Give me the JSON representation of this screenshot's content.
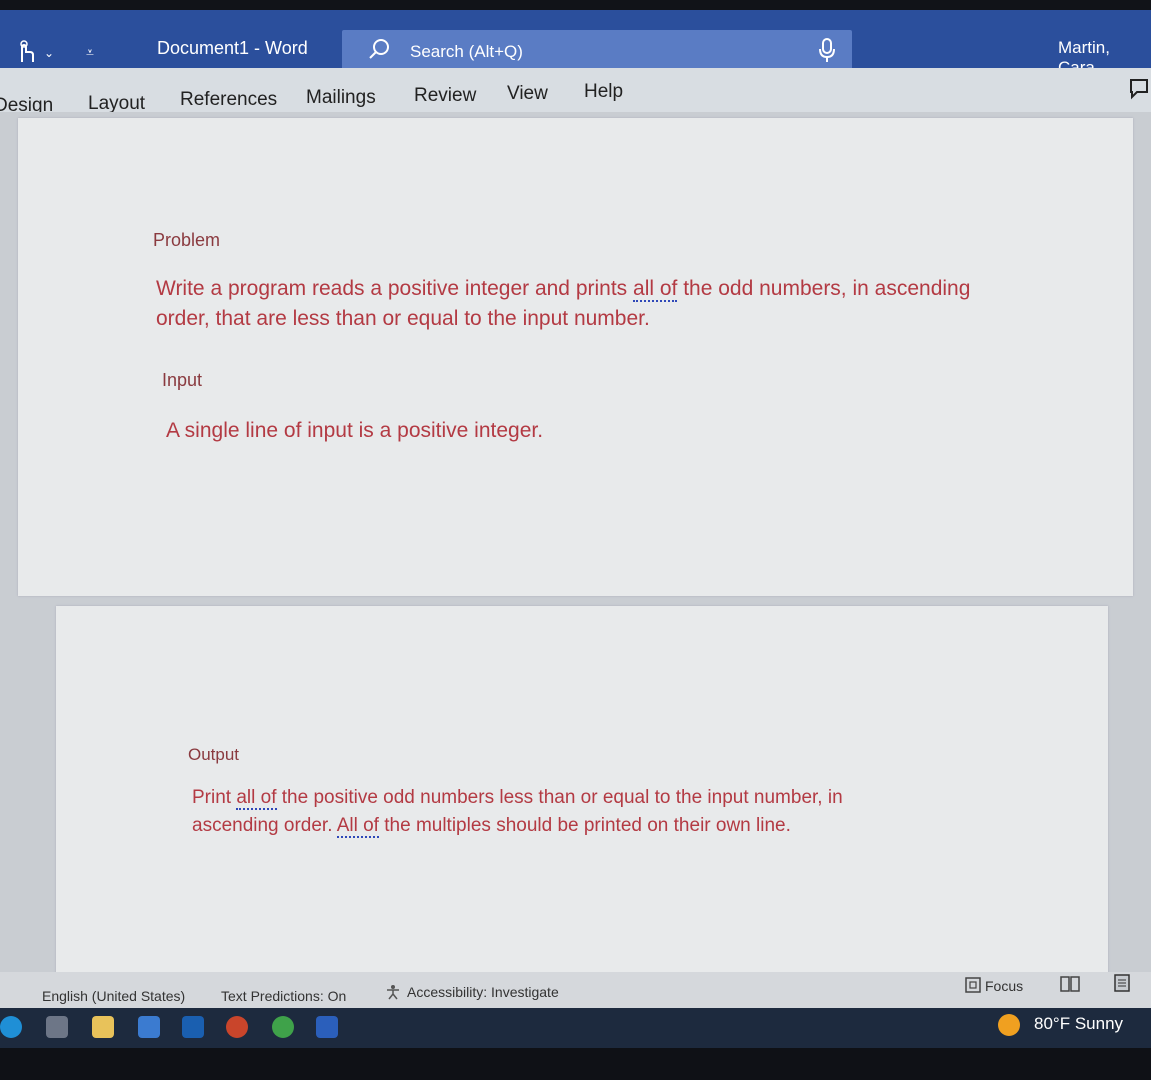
{
  "titlebar": {
    "doc_title": "Document1 - Word",
    "search_placeholder": "Search (Alt+Q)",
    "user_name": "Martin, Cara"
  },
  "ribbon": {
    "tabs": [
      "Design",
      "Layout",
      "References",
      "Mailings",
      "Review",
      "View",
      "Help"
    ]
  },
  "document": {
    "problem_heading": "Problem",
    "problem_text_1": "Write a program reads a positive integer and prints ",
    "problem_text_dotted": "all of",
    "problem_text_2": " the odd numbers, in ascending order, that are less than or equal to the input number.",
    "input_heading": "Input",
    "input_text": "A single line of input is a positive integer.",
    "output_heading": "Output",
    "output_text_1": "Print ",
    "output_text_dotted_1": "all of",
    "output_text_2": " the positive odd numbers less than or equal to the input number, in ascending order. ",
    "output_text_dotted_2": "All of",
    "output_text_3": " the multiples should be printed on their own line."
  },
  "statusbar": {
    "language": "English (United States)",
    "text_predictions": "Text Predictions: On",
    "accessibility": "Accessibility: Investigate",
    "focus": "Focus"
  },
  "taskbar": {
    "weather": "80°F  Sunny"
  },
  "colors": {
    "titlebar": "#2b4f9c",
    "text_red": "#b33a43",
    "heading_red": "#8a3a3f"
  },
  "icons": [
    "touch-mode-icon",
    "customize-qat-icon",
    "search-icon",
    "microphone-icon",
    "comment-icon",
    "accessibility-icon",
    "focus-icon",
    "read-mode-icon",
    "print-layout-icon",
    "edge-icon",
    "task-view-icon",
    "file-explorer-icon",
    "mail-icon",
    "outlook-icon",
    "powerpoint-icon",
    "chrome-icon",
    "word-icon",
    "weather-icon"
  ]
}
